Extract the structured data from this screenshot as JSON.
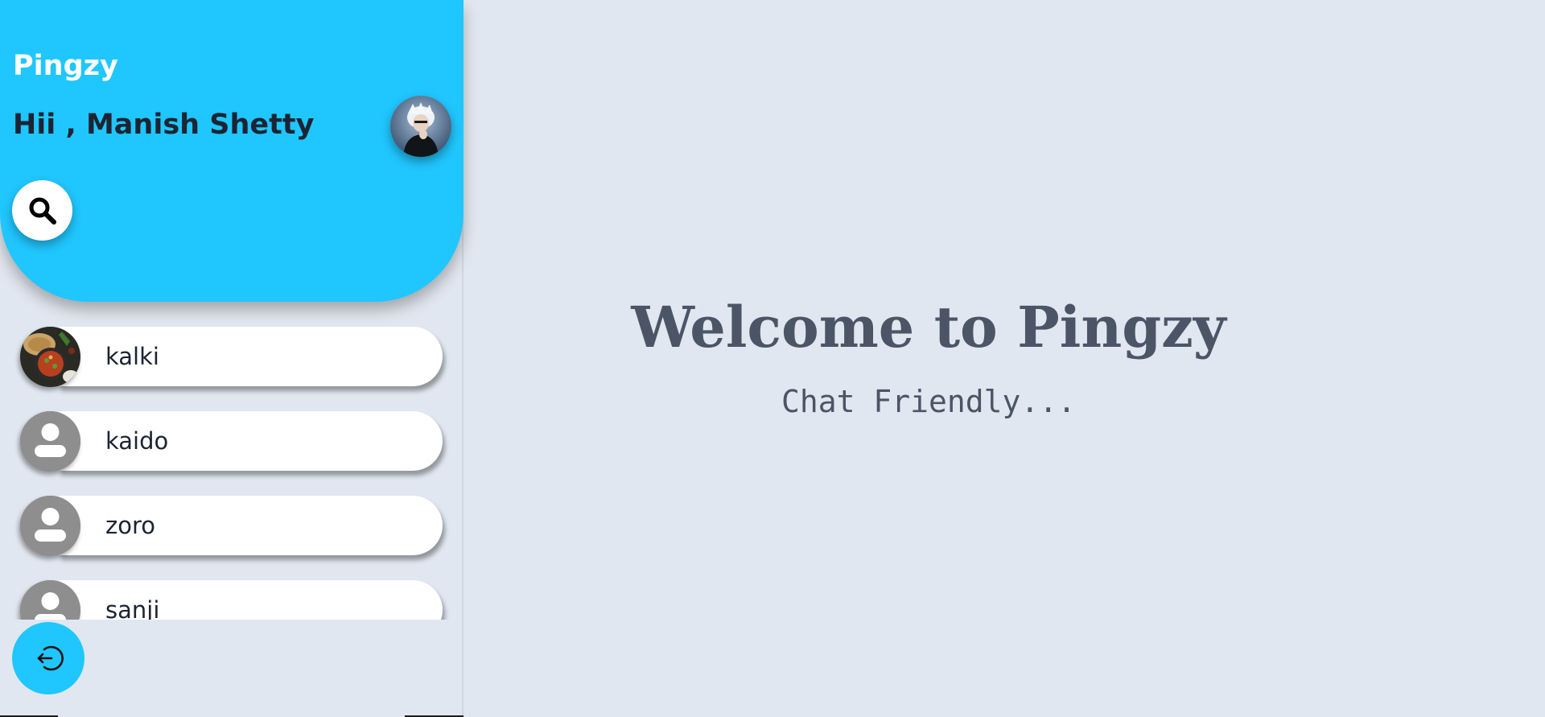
{
  "app": {
    "name": "Pingzy"
  },
  "header": {
    "greeting": "Hii , Manish Shetty",
    "avatar_icon": "user-avatar-photo",
    "search_icon": "search-icon"
  },
  "contacts": [
    {
      "name": "kalki",
      "avatar": "food-photo"
    },
    {
      "name": "kaido",
      "avatar": "default-person-icon"
    },
    {
      "name": "zoro",
      "avatar": "default-person-icon"
    },
    {
      "name": "sanji",
      "avatar": "default-person-icon"
    }
  ],
  "footer": {
    "logout_icon": "logout-icon"
  },
  "main": {
    "title": "Welcome to Pingzy",
    "subtitle": "Chat Friendly..."
  },
  "colors": {
    "accent": "#20c6fe",
    "background": "#e1e7f0",
    "text_dark": "#1c2433",
    "text_muted": "#4b5566"
  }
}
